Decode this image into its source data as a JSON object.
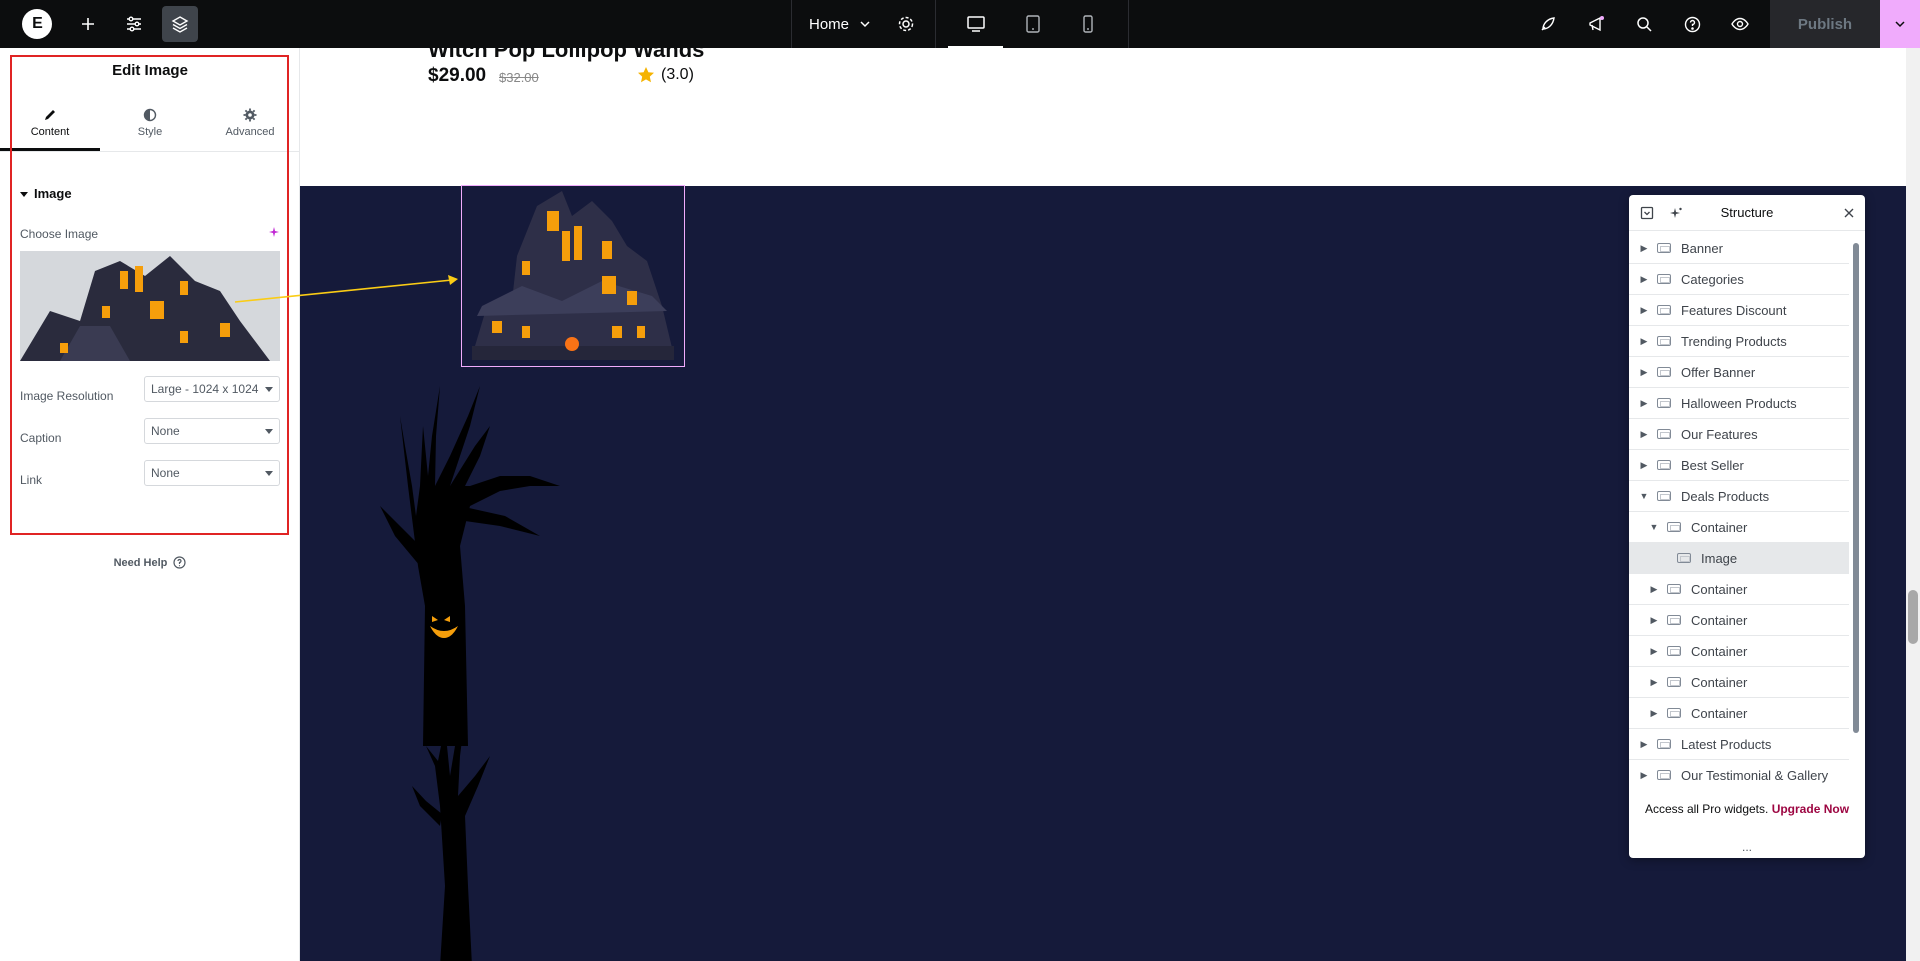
{
  "topbar": {
    "page_selector": "Home",
    "publish_label": "Publish",
    "buttons": [
      "elementor-logo-icon",
      "add-icon",
      "site-settings-icon",
      "structure-icon",
      "settings-gear-icon",
      "desktop-icon",
      "tablet-icon",
      "mobile-icon",
      "launchpad-icon",
      "whats-new-icon",
      "search-icon",
      "help-icon",
      "preview-icon"
    ]
  },
  "panel": {
    "title": "Edit Image",
    "tabs": [
      {
        "label": "Content",
        "icon": "pencil-icon"
      },
      {
        "label": "Style",
        "icon": "half-circle-icon"
      },
      {
        "label": "Advanced",
        "icon": "gear-icon"
      }
    ],
    "section": "Image",
    "choose_image_label": "Choose Image",
    "fields": [
      {
        "label": "Image Resolution",
        "value": "Large - 1024 x 1024"
      },
      {
        "label": "Caption",
        "value": "None"
      },
      {
        "label": "Link",
        "value": "None"
      }
    ],
    "need_help": "Need Help"
  },
  "canvas": {
    "product_title": "Witch Pop Lollipop Wands",
    "price": "$29.00",
    "old_price": "$32.00",
    "rating": "(3.0)"
  },
  "structure": {
    "title": "Structure",
    "items": [
      {
        "label": "Banner",
        "level": 0,
        "expanded": false
      },
      {
        "label": "Categories",
        "level": 0,
        "expanded": false
      },
      {
        "label": "Features Discount",
        "level": 0,
        "expanded": false
      },
      {
        "label": "Trending Products",
        "level": 0,
        "expanded": false
      },
      {
        "label": "Offer Banner",
        "level": 0,
        "expanded": false
      },
      {
        "label": "Halloween Products",
        "level": 0,
        "expanded": false
      },
      {
        "label": "Our Features",
        "level": 0,
        "expanded": false
      },
      {
        "label": "Best Seller",
        "level": 0,
        "expanded": false
      },
      {
        "label": "Deals Products",
        "level": 0,
        "expanded": true
      },
      {
        "label": "Container",
        "level": 1,
        "expanded": true
      },
      {
        "label": "Image",
        "level": 2,
        "expanded": null,
        "selected": true
      },
      {
        "label": "Container",
        "level": 1,
        "expanded": false
      },
      {
        "label": "Container",
        "level": 1,
        "expanded": false
      },
      {
        "label": "Container",
        "level": 1,
        "expanded": false
      },
      {
        "label": "Container",
        "level": 1,
        "expanded": false
      },
      {
        "label": "Container",
        "level": 1,
        "expanded": false
      },
      {
        "label": "Latest Products",
        "level": 0,
        "expanded": false
      },
      {
        "label": "Our Testimonial & Gallery",
        "level": 0,
        "expanded": false
      }
    ],
    "footer_text": "Access all Pro widgets.",
    "footer_link": "Upgrade Now",
    "more": "..."
  },
  "colors": {
    "accent_pink": "#f0abfc",
    "highlight_red": "#e02424",
    "section_bg": "#151a3a",
    "upgrade_link": "#9d0642"
  }
}
